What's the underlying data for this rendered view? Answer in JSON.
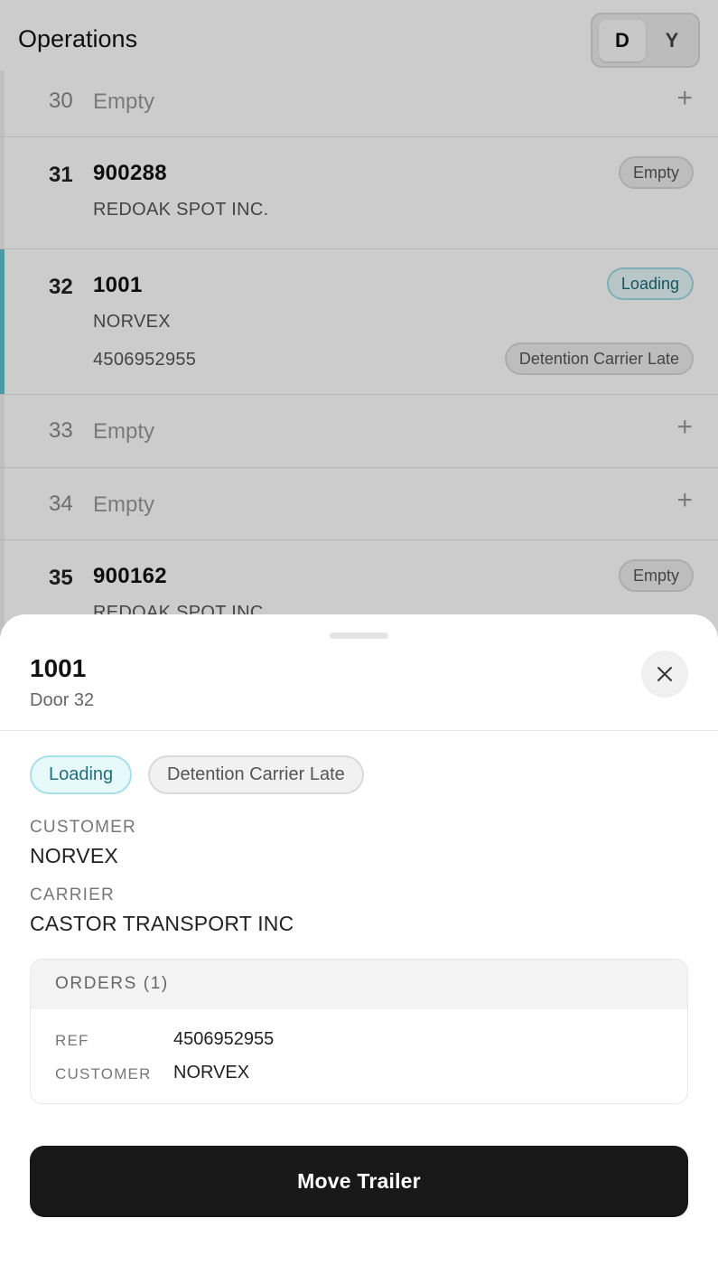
{
  "header": {
    "title": "Operations",
    "view_toggle": {
      "active": "D",
      "inactive": "Y"
    }
  },
  "rows": [
    {
      "door": "30",
      "empty_label": "Empty"
    },
    {
      "door": "31",
      "trailer": "900288",
      "customer": "REDOAK SPOT INC.",
      "status": "Empty"
    },
    {
      "door": "32",
      "trailer": "1001",
      "customer": "NORVEX",
      "ref": "4506952955",
      "status": "Loading",
      "alert": "Detention Carrier Late"
    },
    {
      "door": "33",
      "empty_label": "Empty"
    },
    {
      "door": "34",
      "empty_label": "Empty"
    },
    {
      "door": "35",
      "trailer": "900162",
      "customer": "REDOAK SPOT INC.",
      "status": "Empty"
    }
  ],
  "sheet": {
    "title": "1001",
    "subtitle": "Door 32",
    "tags": [
      "Loading",
      "Detention Carrier Late"
    ],
    "customer_label": "CUSTOMER",
    "customer_value": "NORVEX",
    "carrier_label": "CARRIER",
    "carrier_value": "CASTOR TRANSPORT INC",
    "orders": {
      "title": "ORDERS (1)",
      "ref_label": "REF",
      "ref_value": "4506952955",
      "customer_label": "CUSTOMER",
      "customer_value": "NORVEX"
    },
    "primary_action": "Move Trailer"
  },
  "icons": {
    "add": "plus-icon",
    "close": "close-icon"
  },
  "colors": {
    "accent": "#5fc1ce",
    "primary_button": "#181818"
  }
}
